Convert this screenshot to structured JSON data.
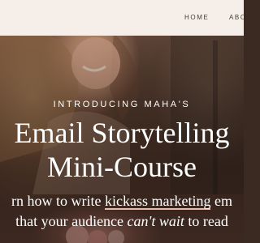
{
  "nav": {
    "items": [
      {
        "label": "HOME"
      },
      {
        "label": "ABO"
      }
    ]
  },
  "hero": {
    "kicker": "INTRODUCING MAHA'S",
    "title_line1": "Email Storytelling",
    "title_line2": "Mini-Course",
    "subtitle": {
      "line1_pre": "rn how to write ",
      "line1_emph": "kickass marketing",
      "line1_post": " em",
      "line2_pre": "that your audience ",
      "line2_emph": "can't wait",
      "line2_post": " to read"
    }
  }
}
